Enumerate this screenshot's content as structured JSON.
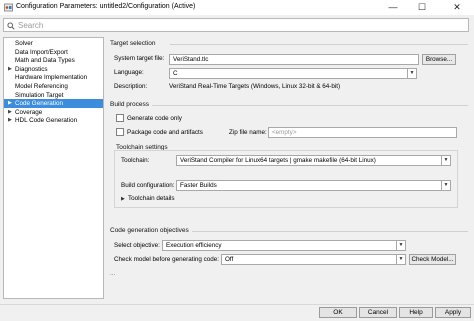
{
  "window": {
    "title": "Configuration Parameters: untitled2/Configuration (Active)",
    "minimize_glyph": "—",
    "maximize_glyph": "☐",
    "close_glyph": "✕"
  },
  "search": {
    "placeholder": "Search"
  },
  "tree": {
    "items": [
      {
        "label": "Solver",
        "expandable": false,
        "selected": false
      },
      {
        "label": "Data Import/Export",
        "expandable": false,
        "selected": false
      },
      {
        "label": "Math and Data Types",
        "expandable": false,
        "selected": false
      },
      {
        "label": "Diagnostics",
        "expandable": true,
        "selected": false
      },
      {
        "label": "Hardware Implementation",
        "expandable": false,
        "selected": false
      },
      {
        "label": "Model Referencing",
        "expandable": false,
        "selected": false
      },
      {
        "label": "Simulation Target",
        "expandable": false,
        "selected": false
      },
      {
        "label": "Code Generation",
        "expandable": true,
        "selected": true
      },
      {
        "label": "Coverage",
        "expandable": true,
        "selected": false
      },
      {
        "label": "HDL Code Generation",
        "expandable": true,
        "selected": false
      }
    ],
    "expand_glyph": "▶"
  },
  "target_selection": {
    "heading": "Target selection",
    "system_target_file_label": "System target file:",
    "system_target_file_value": "VeriStand.tlc",
    "browse_button": "Browse...",
    "language_label": "Language:",
    "language_value": "C",
    "description_label": "Description:",
    "description_value": "VeriStand Real-Time Targets (Windows, Linux 32-bit & 64-bit)"
  },
  "build_process": {
    "heading": "Build process",
    "generate_code_only_label": "Generate code only",
    "generate_code_only_checked": false,
    "package_code_label": "Package code and artifacts",
    "package_code_checked": false,
    "zip_file_name_label": "Zip file name:",
    "zip_file_name_placeholder": "<empty>"
  },
  "toolchain_settings": {
    "heading": "Toolchain settings",
    "toolchain_label": "Toolchain:",
    "toolchain_value": "VeriStand Compiler for Linux64 targets | gmake makefile (64-bit Linux)",
    "build_configuration_label": "Build configuration:",
    "build_configuration_value": "Faster Builds",
    "toolchain_details_label": "Toolchain details",
    "toolchain_details_glyph": "▶"
  },
  "code_generation_objectives": {
    "heading": "Code generation objectives",
    "select_objective_label": "Select objective:",
    "select_objective_value": "Execution efficiency",
    "check_model_label": "Check model before generating code:",
    "check_model_value": "Off",
    "check_model_button": "Check Model...",
    "more_ellipsis": "..."
  },
  "dropdown_glyph": "▼",
  "footer": {
    "ok": "OK",
    "cancel": "Cancel",
    "help": "Help",
    "apply": "Apply"
  }
}
